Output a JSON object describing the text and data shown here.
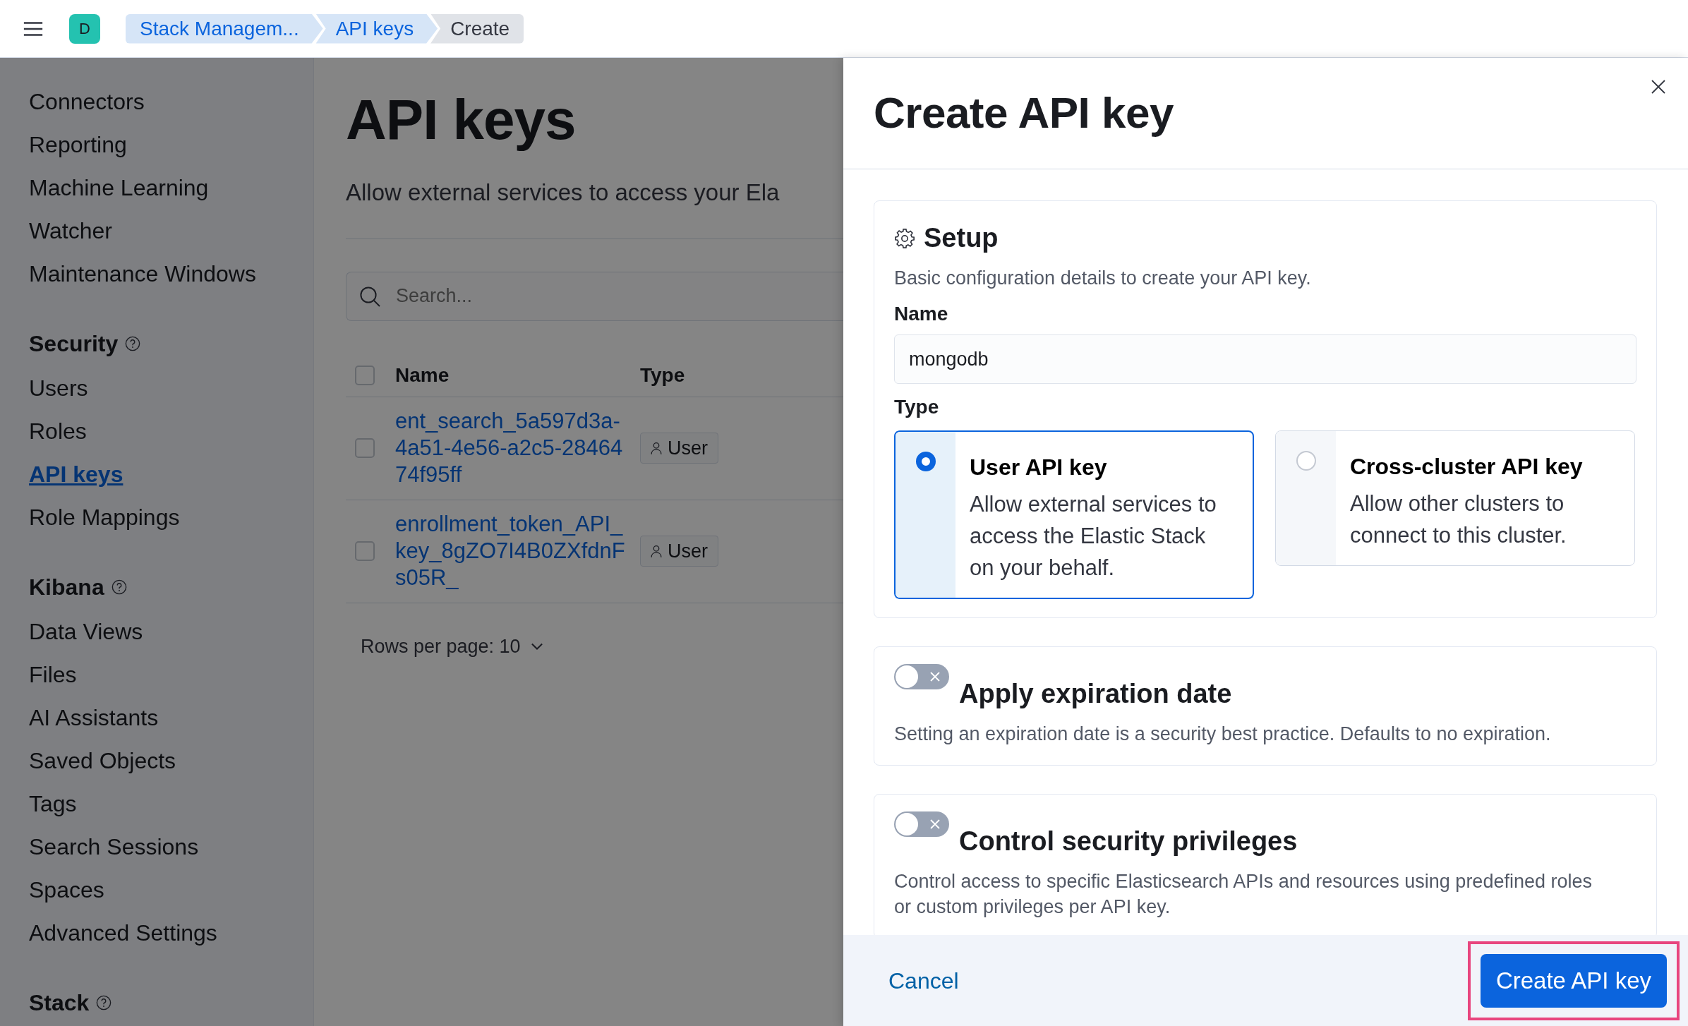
{
  "header": {
    "avatar": "D",
    "breadcrumbs": [
      {
        "label": "Stack Managem...",
        "current": false
      },
      {
        "label": "API keys",
        "current": false
      },
      {
        "label": "Create",
        "current": true
      }
    ]
  },
  "sidebar": {
    "groups": [
      {
        "items": [
          {
            "label": "Connectors",
            "selected": false
          },
          {
            "label": "Reporting",
            "selected": false
          },
          {
            "label": "Machine Learning",
            "selected": false
          },
          {
            "label": "Watcher",
            "selected": false
          },
          {
            "label": "Maintenance Windows",
            "selected": false
          }
        ]
      },
      {
        "title": "Security",
        "items": [
          {
            "label": "Users",
            "selected": false
          },
          {
            "label": "Roles",
            "selected": false
          },
          {
            "label": "API keys",
            "selected": true
          },
          {
            "label": "Role Mappings",
            "selected": false
          }
        ]
      },
      {
        "title": "Kibana",
        "items": [
          {
            "label": "Data Views",
            "selected": false
          },
          {
            "label": "Files",
            "selected": false
          },
          {
            "label": "AI Assistants",
            "selected": false
          },
          {
            "label": "Saved Objects",
            "selected": false
          },
          {
            "label": "Tags",
            "selected": false
          },
          {
            "label": "Search Sessions",
            "selected": false
          },
          {
            "label": "Spaces",
            "selected": false
          },
          {
            "label": "Advanced Settings",
            "selected": false
          }
        ]
      },
      {
        "title": "Stack"
      }
    ]
  },
  "page": {
    "title": "API keys",
    "description": "Allow external services to access your Ela",
    "search": {
      "placeholder": "Search..."
    },
    "table": {
      "columns": [
        "Name",
        "Type"
      ],
      "all_checked": false,
      "rows": [
        {
          "name": "ent_search_5a597d3a-4a51-4e56-a2c5-2846474f95ff",
          "type": "User",
          "checked": false
        },
        {
          "name": "enrollment_token_API_key_8gZO7I4B0ZXfdnFs05R_",
          "type": "User",
          "checked": false
        }
      ]
    },
    "rows_per_page": "Rows per page: 10"
  },
  "flyout": {
    "title": "Create API key",
    "setup": {
      "title": "Setup",
      "description": "Basic configuration details to create your API key.",
      "name_label": "Name",
      "name_value": "mongodb",
      "type_label": "Type",
      "options": [
        {
          "title": "User API key",
          "description": "Allow external services to access the Elastic Stack on your behalf.",
          "selected": true
        },
        {
          "title": "Cross-cluster API key",
          "description": "Allow other clusters to connect to this cluster.",
          "selected": false
        }
      ]
    },
    "sections": [
      {
        "title": "Apply expiration date",
        "description": "Setting an expiration date is a security best practice. Defaults to no expiration.",
        "on": false
      },
      {
        "title": "Control security privileges",
        "description": "Control access to specific Elasticsearch APIs and resources using predefined roles or custom privileges per API key.",
        "on": false
      }
    ],
    "footer": {
      "cancel": "Cancel",
      "submit": "Create API key",
      "highlighted": true
    }
  }
}
